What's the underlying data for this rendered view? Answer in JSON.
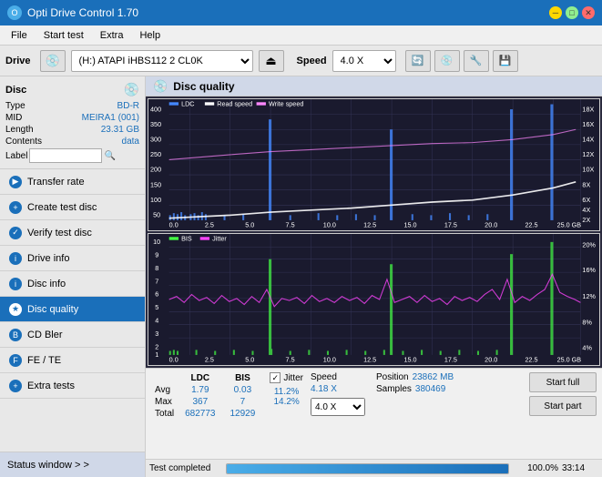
{
  "titleBar": {
    "title": "Opti Drive Control 1.70",
    "iconLabel": "O",
    "minBtn": "─",
    "maxBtn": "□",
    "closeBtn": "✕"
  },
  "menuBar": {
    "items": [
      "File",
      "Start test",
      "Extra",
      "Help"
    ]
  },
  "driveBar": {
    "label": "Drive",
    "driveValue": "(H:) ATAPI iHBS112  2 CL0K",
    "speedLabel": "Speed",
    "speedValue": "4.0 X"
  },
  "discPanel": {
    "title": "Disc",
    "rows": [
      {
        "label": "Type",
        "value": "BD-R"
      },
      {
        "label": "MID",
        "value": "MEIRA1 (001)"
      },
      {
        "label": "Length",
        "value": "23.31 GB"
      },
      {
        "label": "Contents",
        "value": "data"
      }
    ],
    "labelField": "Label"
  },
  "navItems": [
    {
      "label": "Transfer rate",
      "active": false
    },
    {
      "label": "Create test disc",
      "active": false
    },
    {
      "label": "Verify test disc",
      "active": false
    },
    {
      "label": "Drive info",
      "active": false
    },
    {
      "label": "Disc info",
      "active": false
    },
    {
      "label": "Disc quality",
      "active": true
    },
    {
      "label": "CD Bler",
      "active": false
    },
    {
      "label": "FE / TE",
      "active": false
    },
    {
      "label": "Extra tests",
      "active": false
    }
  ],
  "statusWindow": "Status window > >",
  "contentHeader": {
    "title": "Disc quality"
  },
  "chart1": {
    "legend": [
      {
        "label": "LDC",
        "color": "#4488ff"
      },
      {
        "label": "Read speed",
        "color": "#ffffff"
      },
      {
        "label": "Write speed",
        "color": "#ff88ff"
      }
    ],
    "yAxisLeft": [
      "400",
      "350",
      "300",
      "250",
      "200",
      "150",
      "100",
      "50"
    ],
    "yAxisRight": [
      "18X",
      "16X",
      "14X",
      "12X",
      "10X",
      "8X",
      "6X",
      "4X",
      "2X"
    ],
    "xAxis": [
      "0.0",
      "2.5",
      "5.0",
      "7.5",
      "10.0",
      "12.5",
      "15.0",
      "17.5",
      "20.0",
      "22.5",
      "25.0 GB"
    ]
  },
  "chart2": {
    "legend": [
      {
        "label": "BIS",
        "color": "#44ff44"
      },
      {
        "label": "Jitter",
        "color": "#ff44ff"
      }
    ],
    "yAxisLeft": [
      "10",
      "9",
      "8",
      "7",
      "6",
      "5",
      "4",
      "3",
      "2",
      "1"
    ],
    "yAxisRight": [
      "20%",
      "16%",
      "12%",
      "8%",
      "4%"
    ],
    "xAxis": [
      "0.0",
      "2.5",
      "5.0",
      "7.5",
      "10.0",
      "12.5",
      "15.0",
      "17.5",
      "20.0",
      "22.5",
      "25.0 GB"
    ]
  },
  "stats": {
    "headers": [
      "",
      "LDC",
      "BIS",
      "",
      "Jitter",
      "Speed"
    ],
    "avgRow": {
      "label": "Avg",
      "ldc": "1.79",
      "bis": "0.03",
      "jitter": "11.2%",
      "speed": "4.18 X"
    },
    "maxRow": {
      "label": "Max",
      "ldc": "367",
      "bis": "7",
      "jitter": "14.2%"
    },
    "totalRow": {
      "label": "Total",
      "ldc": "682773",
      "bis": "12929"
    },
    "jitterChecked": true,
    "speedDisplay": "4.0 X",
    "positionLabel": "Position",
    "positionVal": "23862 MB",
    "samplesLabel": "Samples",
    "samplesVal": "380469"
  },
  "buttons": {
    "startFull": "Start full",
    "startPart": "Start part"
  },
  "progressBar": {
    "percent": 100,
    "percentText": "100.0%",
    "status": "Test completed",
    "time": "33:14"
  }
}
